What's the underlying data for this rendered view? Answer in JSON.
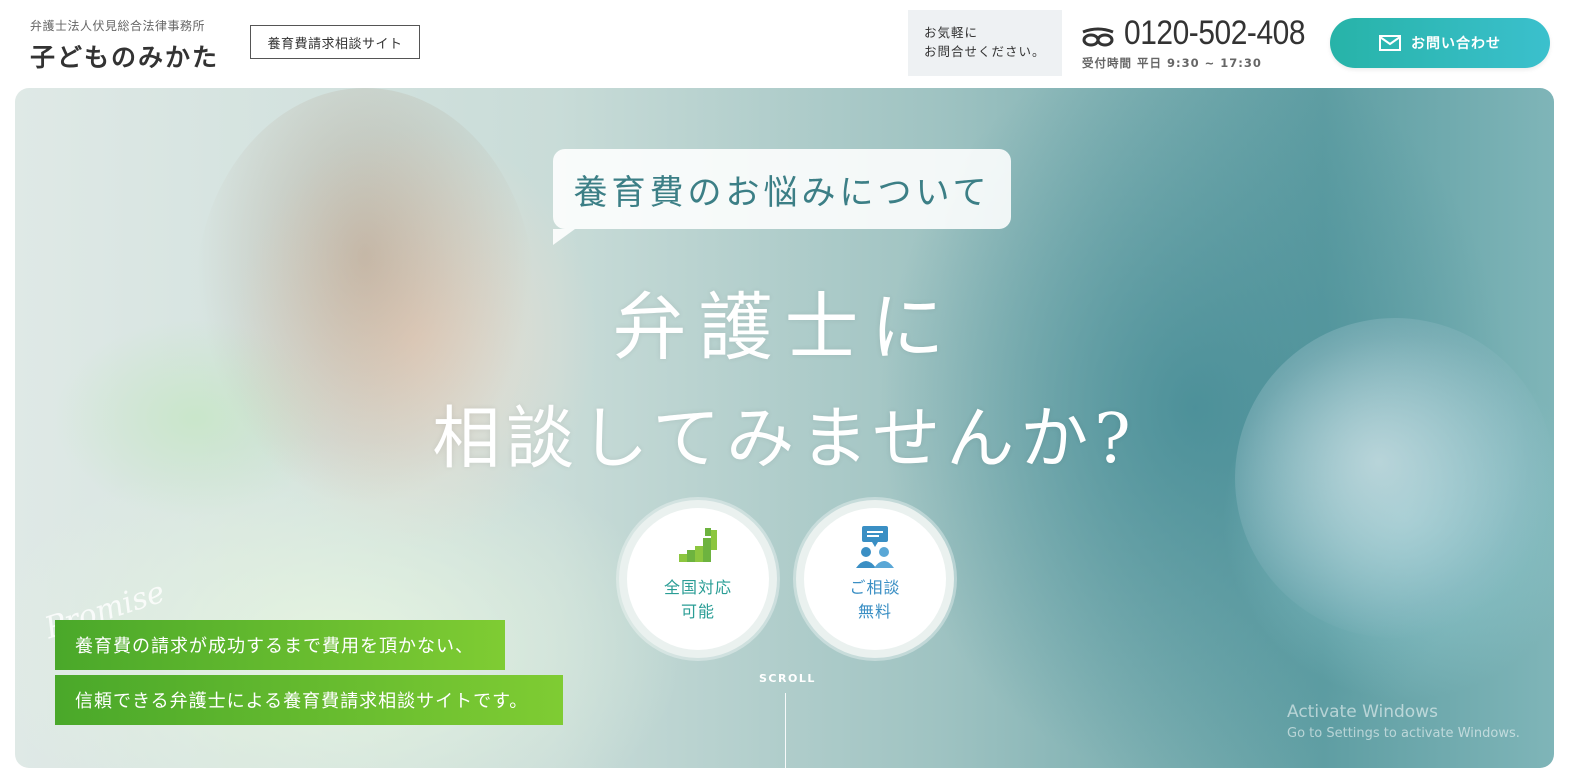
{
  "header": {
    "firm_name": "弁護士法人伏見総合法律事務所",
    "site_name": "子どものみかた",
    "site_tag": "養育費請求相談サイト",
    "contact_note_line1": "お気軽に",
    "contact_note_line2": "お問合せください。",
    "phone_icon": "free-dial-icon",
    "phone_number": "0120-502-408",
    "phone_hours": "受付時間 平日 9:30 ~ 17:30",
    "contact_button_label": "お問い合わせ",
    "contact_button_icon": "mail-icon"
  },
  "hero": {
    "bubble_text": "養育費のお悩みについて",
    "headline_line1": "弁護士に",
    "headline_line2": "相談してみませんか?",
    "features": [
      {
        "icon": "nationwide-map-icon",
        "line1": "全国対応",
        "line2": "可能"
      },
      {
        "icon": "consultation-chat-icon",
        "line1": "ご相談",
        "line2": "無料"
      }
    ],
    "promise_script": "Promise",
    "promise_line1": "養育費の請求が成功するまで費用を頂かない、",
    "promise_line2": "信頼できる弁護士による養育費請求相談サイトです。",
    "scroll_label": "SCROLL"
  },
  "os_watermark": {
    "title": "Activate Windows",
    "subtitle": "Go to Settings to activate Windows."
  },
  "colors": {
    "accent_teal": "#27b3a8",
    "promise_green": "#5cb82e",
    "feature_teal": "#2a9d95",
    "feature_blue": "#3a8fc4"
  }
}
